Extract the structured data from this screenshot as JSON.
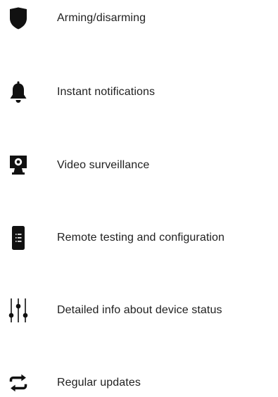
{
  "features": [
    {
      "icon": "shield-icon",
      "label": "Arming/disarming"
    },
    {
      "icon": "bell-icon",
      "label": "Instant notifications"
    },
    {
      "icon": "camera-icon",
      "label": "Video surveillance"
    },
    {
      "icon": "device-list-icon",
      "label": "Remote testing and configuration"
    },
    {
      "icon": "sliders-icon",
      "label": "Detailed info about device status"
    },
    {
      "icon": "repeat-icon",
      "label": "Regular updates"
    }
  ],
  "colors": {
    "icon": "#111111",
    "text": "#1f1f1f",
    "background": "#ffffff"
  }
}
